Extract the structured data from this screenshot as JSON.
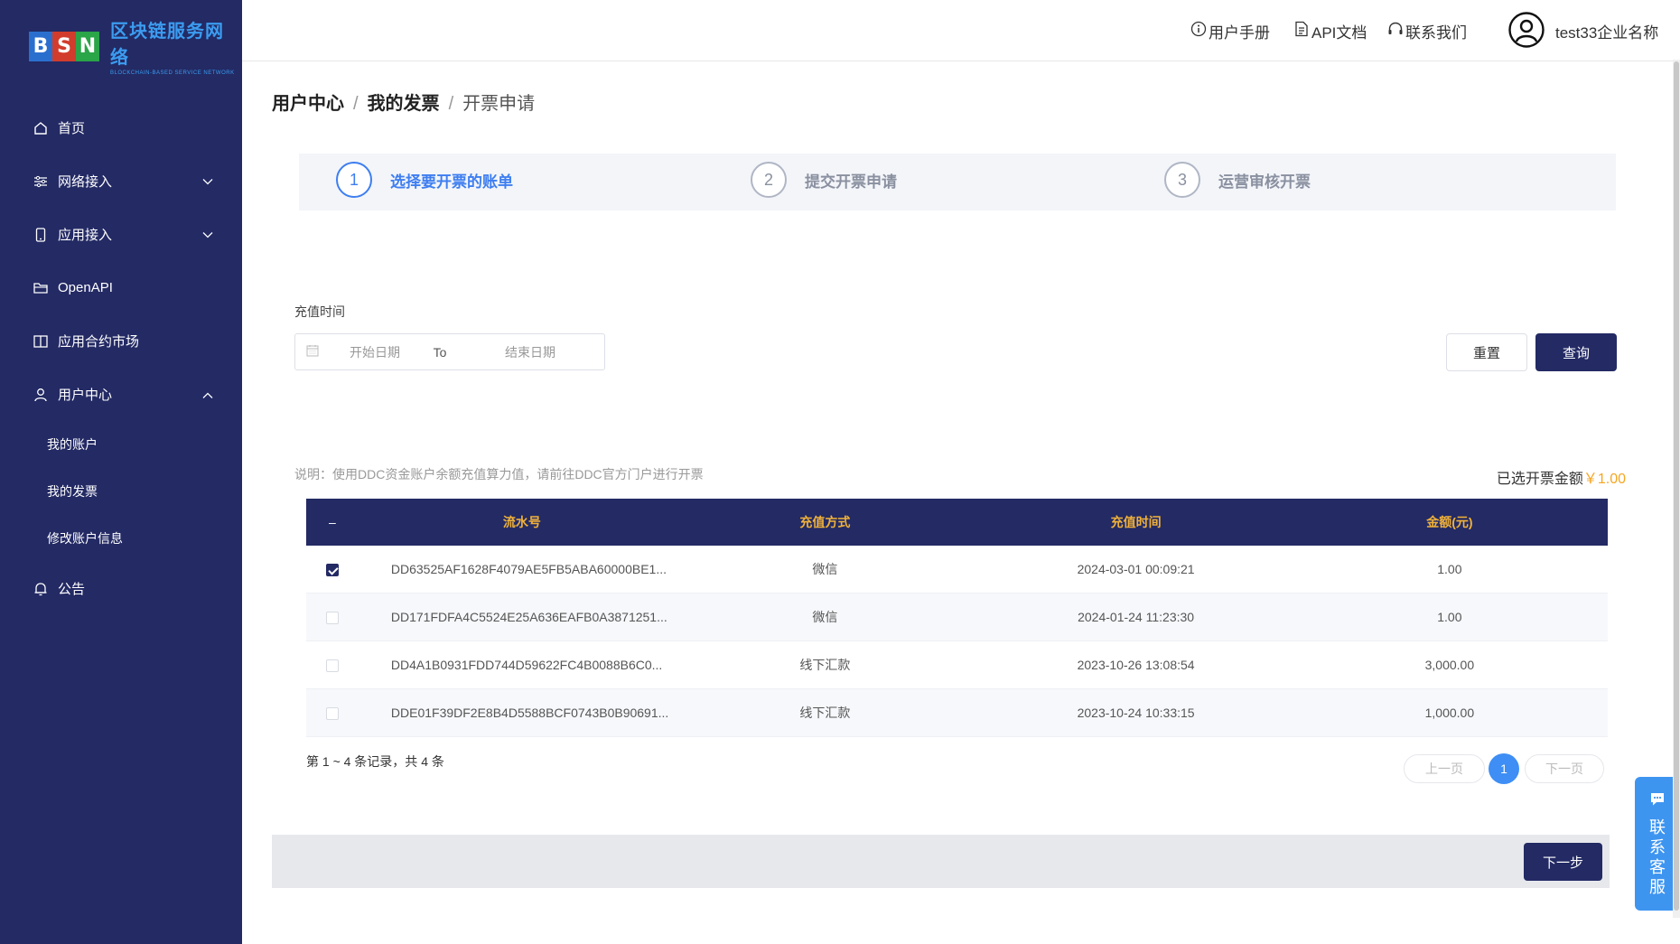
{
  "logo": {
    "letters": [
      "B",
      "S",
      "N"
    ],
    "letter_colors": [
      "#2b6fce",
      "#d23c2c",
      "#2aa548"
    ],
    "title_cn": "区块链服务网络",
    "title_en": "BLOCKCHAIN-BASED SERVICE NETWORK"
  },
  "sidebar": {
    "items": [
      {
        "label": "首页",
        "icon": "home-icon"
      },
      {
        "label": "网络接入",
        "icon": "sliders-icon"
      },
      {
        "label": "应用接入",
        "icon": "mobile-icon"
      },
      {
        "label": "OpenAPI",
        "icon": "folder-icon"
      },
      {
        "label": "应用合约市场",
        "icon": "book-icon"
      },
      {
        "label": "用户中心",
        "icon": "user-icon"
      }
    ],
    "subitems": [
      {
        "label": "我的账户"
      },
      {
        "label": "我的发票"
      },
      {
        "label": "修改账户信息"
      }
    ],
    "notice": {
      "label": "公告",
      "icon": "bell-icon"
    }
  },
  "header": {
    "manual": "用户手册",
    "api_docs": "API文档",
    "contact": "联系我们",
    "company": "test33企业名称"
  },
  "breadcrumb": {
    "level1": "用户中心",
    "level2": "我的发票",
    "level3": "开票申请",
    "separator": "/"
  },
  "steps": [
    {
      "num": "1",
      "label": "选择要开票的账单",
      "active": true
    },
    {
      "num": "2",
      "label": "提交开票申请",
      "active": false
    },
    {
      "num": "3",
      "label": "运营审核开票",
      "active": false
    }
  ],
  "filter": {
    "label": "充值时间",
    "start_placeholder": "开始日期",
    "to": "To",
    "end_placeholder": "结束日期",
    "reset": "重置",
    "query": "查询"
  },
  "note": "说明：使用DDC资金账户余额充值算力值，请前往DDC官方门户进行开票",
  "selected": {
    "label": "已选开票金额",
    "amount": "￥1.00"
  },
  "table": {
    "select_all": "–",
    "columns": [
      "流水号",
      "充值方式",
      "充值时间",
      "金额(元)"
    ],
    "rows": [
      {
        "checked": true,
        "serial": "DD63525AF1628F4079AE5FB5ABA60000BE1...",
        "method": "微信",
        "time": "2024-03-01 00:09:21",
        "amount": "1.00"
      },
      {
        "checked": false,
        "serial": "DD171FDFA4C5524E25A636EAFB0A3871251...",
        "method": "微信",
        "time": "2024-01-24 11:23:30",
        "amount": "1.00"
      },
      {
        "checked": false,
        "serial": "DD4A1B0931FDD744D59622FC4B0088B6C0...",
        "method": "线下汇款",
        "time": "2023-10-26 13:08:54",
        "amount": "3,000.00"
      },
      {
        "checked": false,
        "serial": "DDE01F39DF2E8B4D5588BCF0743B0B90691...",
        "method": "线下汇款",
        "time": "2023-10-24 10:33:15",
        "amount": "1,000.00"
      }
    ]
  },
  "pagination": {
    "summary": "第 1 ~ 4 条记录，共 4 条",
    "prev": "上一页",
    "current": "1",
    "next": "下一页"
  },
  "next_step": "下一步",
  "support": {
    "chars": [
      "联",
      "系",
      "客",
      "服"
    ]
  },
  "colors": {
    "sidebar_bg": "#232a64",
    "accent_blue": "#3e7ef0",
    "header_gold": "#f0b13a",
    "amount_orange": "#f5a623"
  }
}
